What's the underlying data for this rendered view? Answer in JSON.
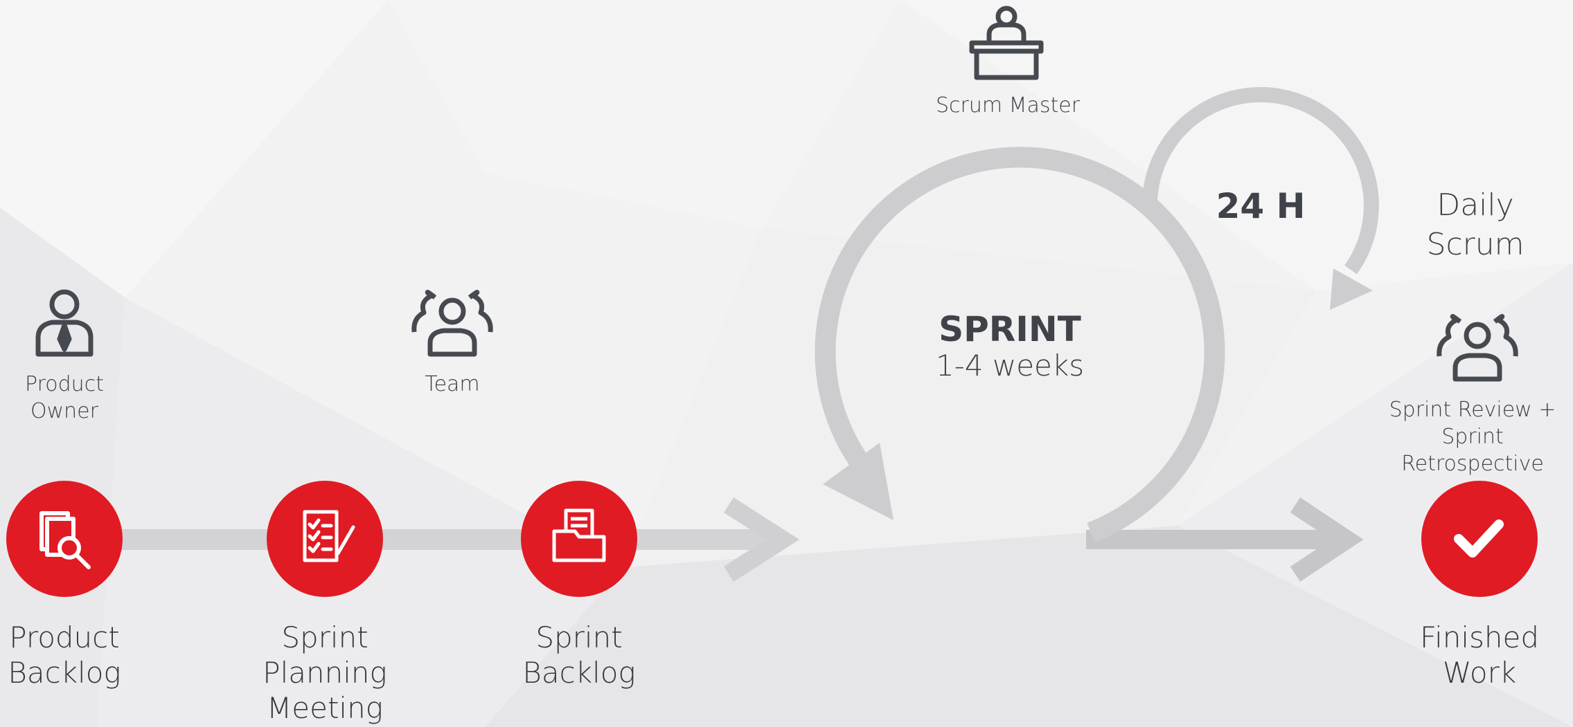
{
  "colors": {
    "accent": "#e01b24",
    "icon": "#464a50",
    "arrow": "#c9c9cb",
    "text": "#3d3f44"
  },
  "roles": {
    "product_owner": {
      "label": "Product\nOwner",
      "icon": "product-owner-icon"
    },
    "team": {
      "label": "Team",
      "icon": "team-icon"
    },
    "scrum_master": {
      "label": "Scrum Master",
      "icon": "scrum-master-icon"
    },
    "review_team": {
      "label": "Sprint Review +\nSprint Retrospective",
      "icon": "team-icon"
    }
  },
  "stages": [
    {
      "label": "Product\nBacklog",
      "icon": "document-search-icon"
    },
    {
      "label": "Sprint\nPlanning\nMeeting",
      "icon": "checklist-pen-icon"
    },
    {
      "label": "Sprint\nBacklog",
      "icon": "folder-documents-icon"
    },
    {
      "label": "Finished\nWork",
      "icon": "checkmark-icon"
    }
  ],
  "sprint": {
    "title": "SPRINT",
    "duration": "1-4 weeks"
  },
  "daily": {
    "cycle": "24 H",
    "label": "Daily Scrum"
  }
}
